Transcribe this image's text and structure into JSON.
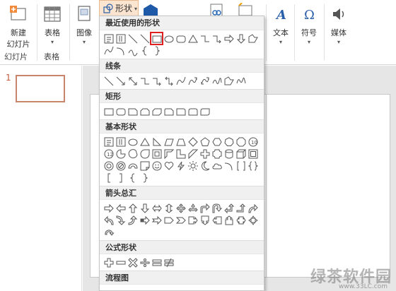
{
  "ribbon": {
    "new_slide_label_line1": "新建",
    "new_slide_label_line2": "幻灯片",
    "table_label": "表格",
    "image_label": "图像",
    "shapes_label": "形状",
    "text_label": "文本",
    "symbol_label": "符号",
    "media_label": "媒体",
    "group_slides_label": "幻灯片",
    "group_tables_label": "表格"
  },
  "thumbnails": {
    "slide_number": "1"
  },
  "shapes_menu": {
    "sections": [
      {
        "title": "最近使用的形状",
        "shapes": [
          "textbox",
          "vtextbox",
          "line",
          "line",
          "rect-selected",
          "oval",
          "roundrect",
          "triangle",
          "elbow",
          "elbow-arrow",
          "right-arrow",
          "down-arrow",
          "freeform",
          "curve",
          "arc",
          "arc2",
          "brace-left",
          "brace-right"
        ]
      },
      {
        "title": "线条",
        "shapes": [
          "line",
          "arrow-line",
          "double-arrow-line",
          "elbow",
          "elbow-arrow",
          "elbow-double",
          "curve",
          "curve-arrow",
          "curve-double",
          "squiggle",
          "freeform",
          "scribble"
        ]
      },
      {
        "title": "矩形",
        "shapes": [
          "rect",
          "roundrect",
          "snip1",
          "snip2",
          "snip3",
          "snipround",
          "round1",
          "round2",
          "rounddiag"
        ]
      },
      {
        "title": "基本形状",
        "shapes": [
          "textbox",
          "vtextbox",
          "oval",
          "triangle",
          "rtriangle",
          "parallelogram",
          "trapezoid",
          "diamond",
          "pentagon",
          "hexagon",
          "heptagon",
          "octagon",
          "decagon",
          "dodecagon",
          "pie",
          "chord",
          "teardrop",
          "frame",
          "halfframe",
          "lshape",
          "diagstripe",
          "cross",
          "plaque",
          "can",
          "cube",
          "bevel",
          "donut",
          "noentry",
          "blockarc",
          "foldedcorner",
          "smiley",
          "heart",
          "lightning",
          "sun",
          "moon",
          "cloud",
          "arc",
          "bracket-pair",
          "brace-pair",
          "bracket-left",
          "bracket-right",
          "brace-left",
          "brace-right"
        ]
      },
      {
        "title": "箭头总汇",
        "shapes": [
          "right-arrow",
          "left-arrow",
          "up-arrow",
          "down-arrow",
          "lr-arrow",
          "ud-arrow",
          "quad-arrow",
          "lru-arrow",
          "bent-arrow",
          "uturn",
          "lu-arrow",
          "bentup-arrow",
          "curved-r",
          "curved-l",
          "curved-u",
          "curved-d",
          "striped-r",
          "notched-r",
          "pentagon-arrow",
          "chevron",
          "right-callout",
          "down-callout",
          "left-callout",
          "up-callout",
          "lr-callout",
          "quad-callout",
          "circular"
        ]
      },
      {
        "title": "公式形状",
        "shapes": [
          "plus",
          "minus",
          "multiply",
          "divide",
          "equal",
          "notequal"
        ]
      },
      {
        "title": "流程图",
        "shapes": []
      }
    ]
  },
  "watermark": {
    "text": "绿茶软件园",
    "url": "www.33LC.com"
  },
  "colors": {
    "accent": "#c55a3b",
    "shapes_button_bg": "#fbe5d0",
    "selection_red": "#e02020"
  }
}
